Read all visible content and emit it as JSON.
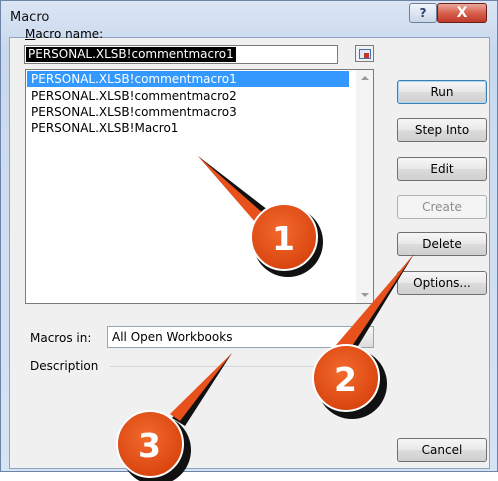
{
  "window": {
    "title": "Macro"
  },
  "titlebar_buttons": {
    "help": "?",
    "close": "X"
  },
  "macro_name": {
    "label": "Macro name:",
    "value": "PERSONAL.XLSB!commentmacro1"
  },
  "macro_list": [
    "PERSONAL.XLSB!commentmacro1",
    "PERSONAL.XLSB!commentmacro2",
    "PERSONAL.XLSB!commentmacro3",
    "PERSONAL.XLSB!Macro1"
  ],
  "selected_index": 0,
  "buttons": {
    "run": "Run",
    "step_into": "Step Into",
    "edit": "Edit",
    "create": "Create",
    "delete": "Delete",
    "options": "Options...",
    "cancel": "Cancel"
  },
  "macros_in": {
    "label": "Macros in:",
    "value": "All Open Workbooks"
  },
  "description": {
    "label": "Description"
  },
  "callouts": [
    "1",
    "2",
    "3"
  ],
  "colors": {
    "callout": "#e8501c",
    "selection": "#3399ff",
    "close_button": "#c0392b"
  }
}
